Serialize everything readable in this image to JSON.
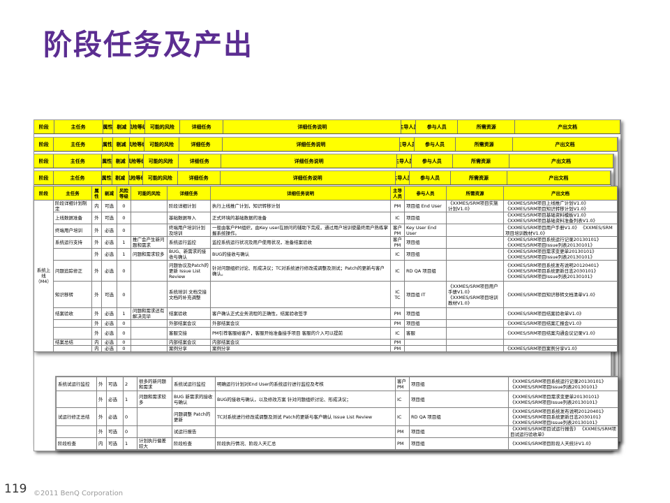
{
  "slide": {
    "title": "阶段任务及产出",
    "page_number": "119",
    "copyright": "©2011 BenQ Corporation"
  },
  "header": {
    "stage": "阶段",
    "main_task": "主任务",
    "attr": "属性",
    "cut": "剔减",
    "risk_level": "风险等级",
    "risk": "可能的风险",
    "detail_task": "详细任务",
    "detail_desc": "详细任务说明",
    "lead": "主导人员",
    "participants": "参与人员",
    "resources": "所需资源",
    "outputs": "产出文档"
  },
  "stage_label": "系统上线（M4）",
  "rows": [
    {
      "main": "阶段详细计划制定",
      "attr": "内",
      "cut": "可选",
      "lvl": "0",
      "risk": "",
      "dt": "阶段详细计划",
      "desc": "执行上线推广计划，知识转移计划",
      "lead": "PM",
      "part": "项目组 End User",
      "res": "《XXMES/SRM项目实施计划V1.0》",
      "out": "《XXMES/SRM项目上线推广计划V1.0》 《XXMES/SRM项目知识转移计划V1.0》"
    },
    {
      "main": "上线数据准备",
      "attr": "外",
      "cut": "可选",
      "lvl": "0",
      "risk": "",
      "dt": "基础数据导入",
      "desc": "正式环境的基础数据的准备",
      "lead": "IC",
      "part": "项目组",
      "res": "",
      "out": "《XXMES/SRM项目基础资料模板V1.0》 《XXMES/SRM项目基础资料准备列表V1.0》"
    },
    {
      "main": "终端用户培训",
      "attr": "外",
      "cut": "必选",
      "lvl": "0",
      "risk": "",
      "dt": "终端用户培训计划及培训",
      "desc": "一般由客户PM组织，由Key user在顾问的辅助下完成，通过用户培训使最终用户熟练掌握系统操作。",
      "lead": "客户 PM",
      "part": "Key User End User",
      "res": "",
      "out": "《XXMES/SRM项目用户手册V1.0》 《XXMES/SRM项目培训教材V1.0》"
    },
    {
      "main": "系统运行支持",
      "attr": "外",
      "cut": "必选",
      "lvl": "1",
      "risk": "推广会产生新问题和需求",
      "dt": "系统运行监控",
      "desc": "监控系统运行状况及用户使用状况，准备结案验收",
      "lead": "客户 PM",
      "part": "项目组",
      "res": "",
      "out": "《XXMES/SRM项目系统运行记录20130101》 《XXMES/SRM项目Issue列表20130101》"
    },
    {
      "main": "",
      "attr": "外",
      "cut": "必选",
      "lvl": "1",
      "risk": "问题和需求较多",
      "dt": "BUG、新需求的接收与确认",
      "desc": "BUG的接收与确认",
      "lead": "IC",
      "part": "项目组",
      "res": "",
      "out": "《XXMES/SRM项目需求变更单20130101》 《XXMES/SRM项目Issue列表20130101》"
    },
    {
      "main": "问题追踪修正",
      "attr": "外",
      "cut": "必选",
      "lvl": "0",
      "risk": "",
      "dt": "问题协议及Patch的更新 Issue List Review",
      "desc": "针对问题组织讨论、形成决议；TC对系统进行修改或调整及测试；Patch的更新与客户确认。",
      "lead": "IC",
      "part": "RD QA 项目组",
      "res": "",
      "out": "《XXMES/SRM项目系统发布说明20120401》 《XXMES/SRM项目系统更新日志2030101》 《XXMES/SRM项目Issue列表20130101》"
    },
    {
      "main": "知识移转",
      "attr": "外",
      "cut": "可选",
      "lvl": "0",
      "risk": "",
      "dt": "系统培训 文档交接 文档的补充调整",
      "desc": "",
      "lead": "IC TC",
      "part": "项目组 IT",
      "res": "《XXMES/SRM项目用户手册V1.0》 《XXMES/SRM项目培训教材V1.0》",
      "out": "《XXMES/SRM项目知识移转文档清单V1.0》"
    },
    {
      "main": "结案验收",
      "attr": "外",
      "cut": "必选",
      "lvl": "1",
      "risk": "问题和需求还有解决完毕",
      "dt": "结案验收",
      "desc": "客户确认正式业务流程的正确性，结案验收签字",
      "lead": "PM",
      "part": "项目组",
      "res": "",
      "out": "《XXMES/SRM项目结案验收单V1.0》"
    },
    {
      "main": "",
      "attr": "外",
      "cut": "必选",
      "lvl": "0",
      "risk": "",
      "dt": "外部结案会议",
      "desc": "外部结案会议",
      "lead": "PM",
      "part": "项目组",
      "res": "",
      "out": "《XXMES/SRM项目结案汇报会V1.0》"
    },
    {
      "main": "",
      "attr": "外",
      "cut": "必选",
      "lvl": "0",
      "risk": "",
      "dt": "客服交接",
      "desc": "PM引荐客服给客户，客服开始准备接手项目 客服的介入可以提前",
      "lead": "IC",
      "part": "客服",
      "res": "",
      "out": "《XXMES/SRM项目结案沟通会议记录V1.0》"
    },
    {
      "main": "结案总结",
      "attr": "内",
      "cut": "必选",
      "lvl": "0",
      "risk": "",
      "dt": "内部结案会议",
      "desc": "内部结案会议",
      "lead": "PM",
      "part": "",
      "res": "",
      "out": ""
    },
    {
      "main": "",
      "attr": "内",
      "cut": "必选",
      "lvl": "0",
      "risk": "",
      "dt": "案例分享",
      "desc": "案例分享",
      "lead": "PM",
      "part": "",
      "res": "",
      "out": "《XXMES/SRM项目案例分享V1.0》"
    }
  ],
  "tail_rows": [
    {
      "main": "系统试运行监控",
      "attr": "外",
      "cut": "可选",
      "lvl": "2",
      "risk": "很多的新问题和需求",
      "dt": "系统试运行监控",
      "desc": "明确运行计划对End User的系统运行进行监控及考核",
      "lead": "客户 PM",
      "part": "项目组",
      "out": "《XXMES/SRM项目系统运行记录20130101》 《XXMES/SRM项目Issue列表20130101》"
    },
    {
      "main": "",
      "attr": "外",
      "cut": "必选",
      "lvl": "1",
      "risk": "问题和需求较多",
      "dt": "BUG 新需求的接收与确认",
      "desc": "BUG的接收与确认，以及修改方案 针对问题组织讨论、形成决议；",
      "lead": "IC",
      "part": "项目组",
      "out": "《XXMES/SRM项目需求变更单20130101》 《XXMES/SRM项目Issue列表20130101》"
    },
    {
      "main": "试运行修正总结",
      "attr": "外",
      "cut": "必选",
      "lvl": "0",
      "risk": "",
      "dt": "问题调整 Patch的更新",
      "desc": "TC对系统进行修改或调整及测试 Patch的更新与客户确认 Issue List Review",
      "lead": "IC",
      "part": "RD QA 项目组",
      "out": "《XXMES/SRM项目系统发布说明20120401》 《XXMES/SRM项目系统更新日志2030101》 《XXMES/SRM项目Issue列表20130101》"
    },
    {
      "main": "",
      "attr": "外",
      "cut": "可选",
      "lvl": "0",
      "risk": "",
      "dt": "试运行报告",
      "desc": "",
      "lead": "PM",
      "part": "项目组",
      "out": "《XXMES/SRM项目试运行报告》 《XXMES/SRM项目试运行验收单》"
    },
    {
      "main": "阶段检查",
      "attr": "内",
      "cut": "可选",
      "lvl": "1",
      "risk": "计划执行偏差较大",
      "dt": "阶段检查",
      "desc": "阶段执行情况、阶段人天汇总",
      "lead": "PM",
      "part": "项目组",
      "out": "《XXMES/SRM项目阶段人天统计V1.0》"
    }
  ],
  "colors": {
    "title": "#5b2d91",
    "header_bg": "#ffff00",
    "grid": "#808080"
  }
}
